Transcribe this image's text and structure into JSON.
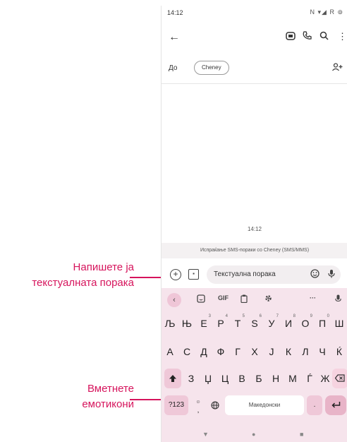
{
  "status_bar": {
    "time": "14:12",
    "icons": "N ▾◢ R ⊚"
  },
  "app_bar": {
    "back_icon": "←",
    "menu_icon": "⋮"
  },
  "recipient": {
    "to_label": "До",
    "chip_text": "Cheney"
  },
  "conversation": {
    "timestamp": "14:12",
    "sms_info": "Испраќање SMS-пораки со Cheney (SMS/MMS)"
  },
  "compose": {
    "placeholder": "Текстуална порака"
  },
  "keyboard": {
    "toolbar": {
      "collapse": "‹",
      "gif": "GIF",
      "more": "···"
    },
    "row1": [
      {
        "k": "Љ",
        "n": ""
      },
      {
        "k": "Њ",
        "n": ""
      },
      {
        "k": "Е",
        "n": "3"
      },
      {
        "k": "Р",
        "n": "4"
      },
      {
        "k": "Т",
        "n": "5"
      },
      {
        "k": "Ѕ",
        "n": "6"
      },
      {
        "k": "У",
        "n": "7"
      },
      {
        "k": "И",
        "n": "8"
      },
      {
        "k": "О",
        "n": "9"
      },
      {
        "k": "П",
        "n": "0"
      },
      {
        "k": "Ш",
        "n": ""
      }
    ],
    "row2": [
      "А",
      "С",
      "Д",
      "Ф",
      "Г",
      "Х",
      "Ј",
      "К",
      "Л",
      "Ч",
      "Ќ"
    ],
    "row3": [
      "З",
      "Џ",
      "Ц",
      "В",
      "Б",
      "Н",
      "М",
      "Ѓ",
      "Ж"
    ],
    "symbols_key": "?123",
    "space_label": "Македонски",
    "period": ".",
    "comma": ","
  },
  "callouts": {
    "write_message": [
      "Напишете ја",
      "текстуалната порака"
    ],
    "insert_emoji": [
      "Вметнете",
      "емотикони"
    ]
  },
  "colors": {
    "accent": "#d6145c",
    "keyboard_bg": "#f6e4ec"
  }
}
